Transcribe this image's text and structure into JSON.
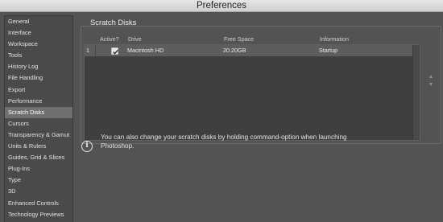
{
  "window": {
    "title": "Preferences"
  },
  "sidebar": {
    "items": [
      {
        "label": "General"
      },
      {
        "label": "Interface"
      },
      {
        "label": "Workspace"
      },
      {
        "label": "Tools"
      },
      {
        "label": "History Log"
      },
      {
        "label": "File Handling"
      },
      {
        "label": "Export"
      },
      {
        "label": "Performance"
      },
      {
        "label": "Scratch Disks",
        "selected": true
      },
      {
        "label": "Cursors"
      },
      {
        "label": "Transparency & Gamut"
      },
      {
        "label": "Units & Rulers"
      },
      {
        "label": "Guides, Grid & Slices"
      },
      {
        "label": "Plug-Ins"
      },
      {
        "label": "Type"
      },
      {
        "label": "3D"
      },
      {
        "label": "Enhanced Controls"
      },
      {
        "label": "Technology Previews"
      }
    ]
  },
  "scratch_disks": {
    "title": "Scratch Disks",
    "columns": {
      "active": "Active?",
      "drive": "Drive",
      "free_space": "Free Space",
      "information": "Information"
    },
    "rows": [
      {
        "index": "1",
        "active": true,
        "drive": "Macintosh HD",
        "free_space": "20.20GB",
        "information": "Startup"
      }
    ],
    "move_up_icon": "triangle-up-icon",
    "move_down_icon": "triangle-down-icon"
  },
  "info": {
    "icon": "info-icon",
    "text": "You can also change your scratch disks by holding command-option when launching Photoshop."
  },
  "colors": {
    "background": "#535353",
    "sidebar_selected": "#6f6f6f",
    "row_selected": "#5d5d5d"
  }
}
